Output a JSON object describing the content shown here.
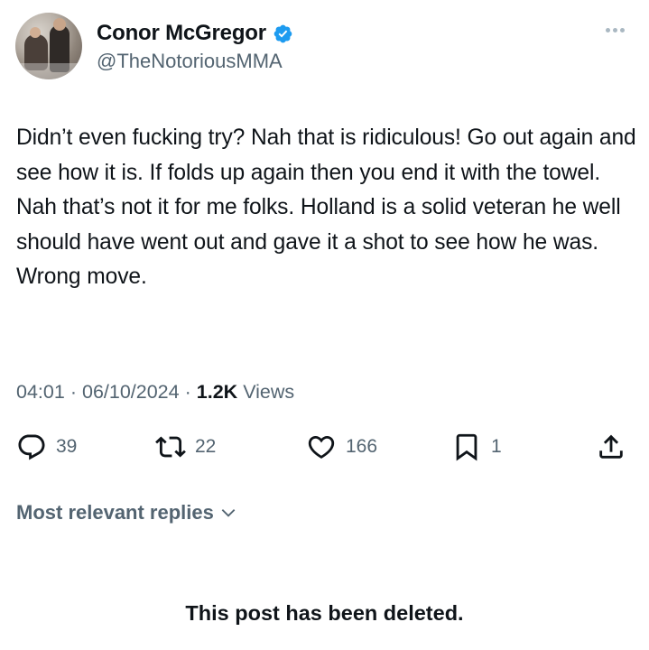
{
  "author": {
    "display_name": "Conor McGregor",
    "handle": "@TheNotoriousMMA",
    "verified": true,
    "avatar_icon": "profile-photo"
  },
  "tweet": {
    "text": "Didn’t even fucking try? Nah that is ridiculous! Go out again and see how it is. If folds up again then you end it with the towel. Nah that’s not it for me folks. Holland is a solid veteran he well should have went out and gave it a shot to see how he was. Wrong move.",
    "time": "04:01",
    "date": "06/10/2024",
    "separator": "·",
    "views_count": "1.2K",
    "views_label": "Views"
  },
  "actions": {
    "replies": "39",
    "reposts": "22",
    "likes": "166",
    "bookmarks": "1",
    "icons": [
      "reply-icon",
      "repost-icon",
      "like-icon",
      "bookmark-icon",
      "share-icon"
    ]
  },
  "replies_filter": {
    "label": "Most relevant replies"
  },
  "notice": {
    "text": "This post has been deleted."
  },
  "colors": {
    "text": "#0f1419",
    "secondary": "#536471",
    "verified_blue": "#1d9bf0",
    "background": "#ffffff"
  }
}
